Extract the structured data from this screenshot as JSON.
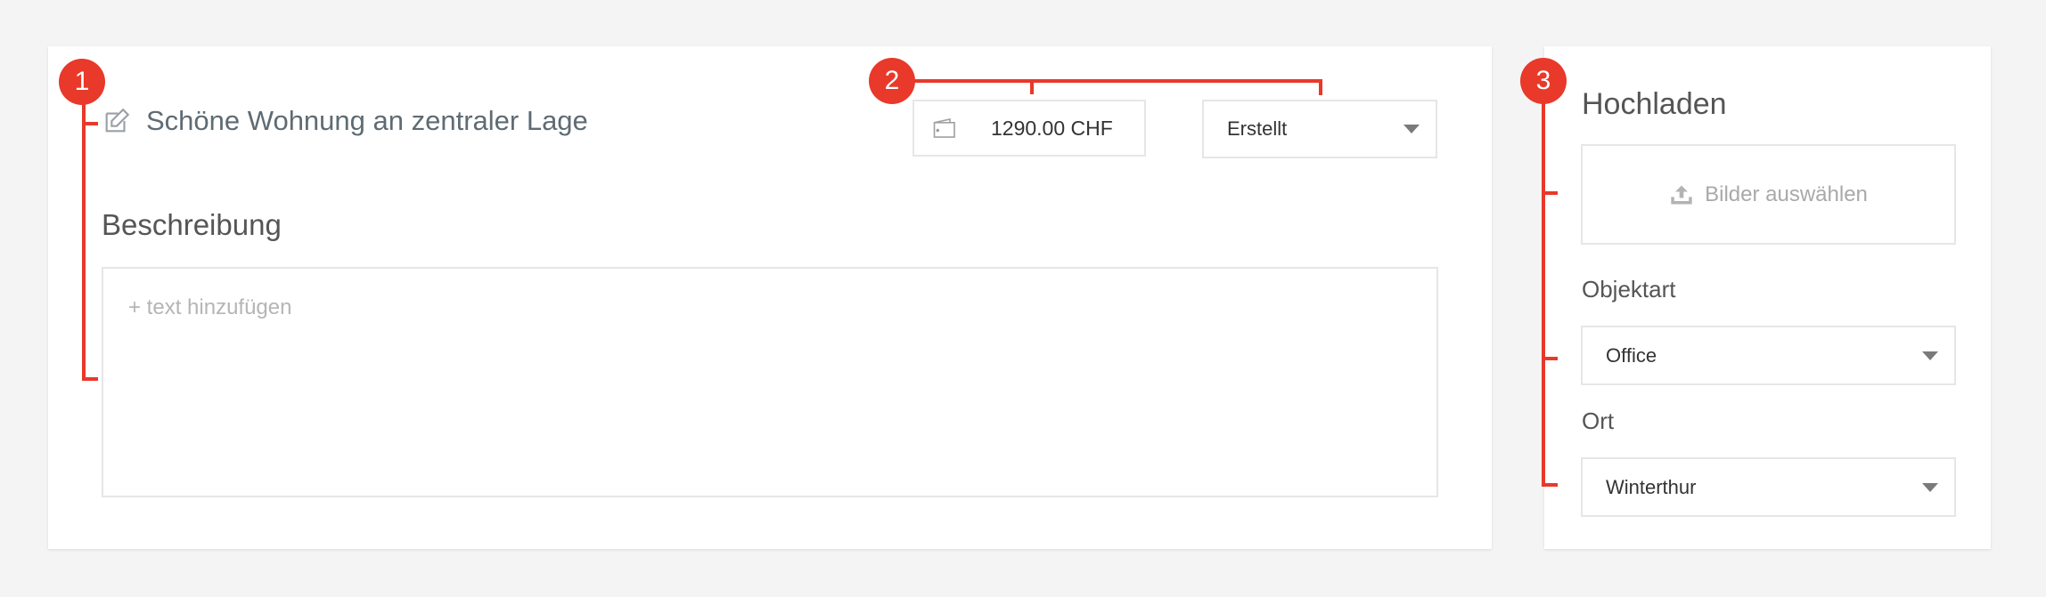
{
  "listing": {
    "title": "Schöne Wohnung an zentraler Lage",
    "price": "1290.00 CHF",
    "status": "Erstellt",
    "description_heading": "Beschreibung",
    "description_placeholder": "+ text hinzufügen"
  },
  "sidebar": {
    "upload_heading": "Hochladen",
    "upload_button": "Bilder auswählen",
    "objektart_label": "Objektart",
    "objektart_value": "Office",
    "ort_label": "Ort",
    "ort_value": "Winterthur"
  },
  "annotations": {
    "badge_1": "1",
    "badge_2": "2",
    "badge_3": "3",
    "color": "#e8392a"
  },
  "icons": {
    "edit": "edit-icon",
    "wallet": "wallet-icon",
    "upload": "upload-icon",
    "caret": "chevron-down-icon"
  }
}
